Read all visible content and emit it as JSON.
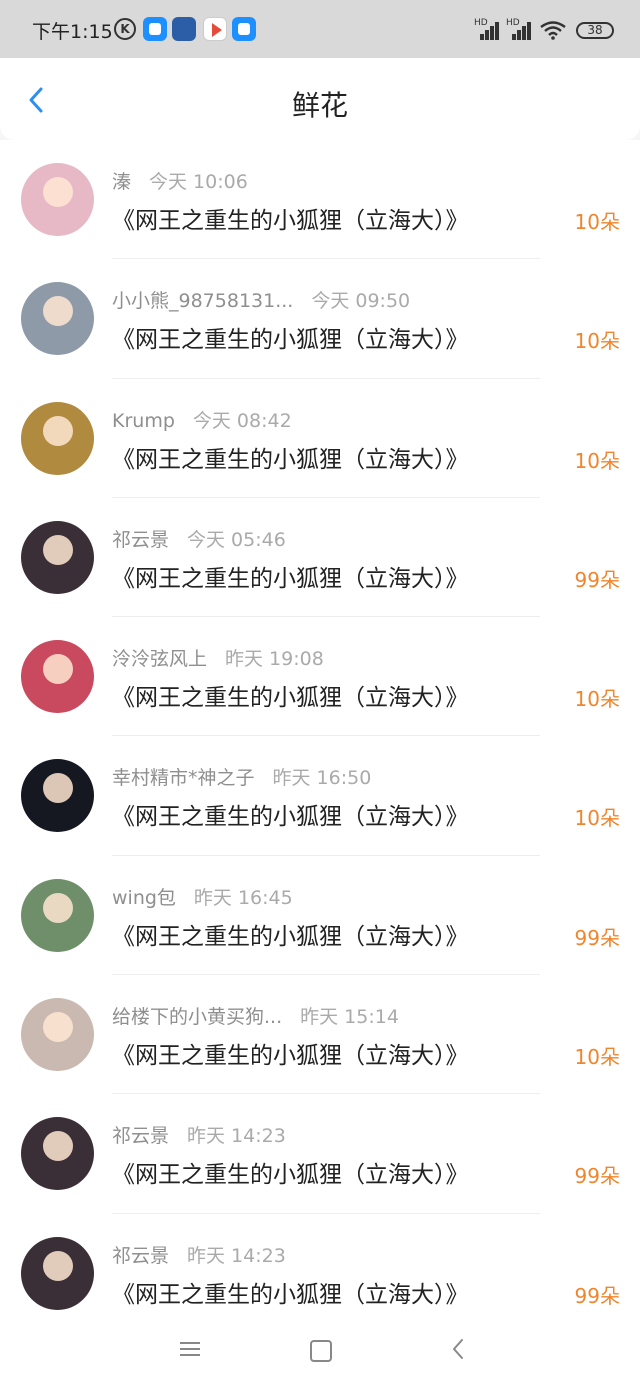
{
  "status_bar": {
    "time": "下午1:15",
    "k_icon": "K",
    "battery": "38",
    "icons": [
      "k-circle-icon",
      "blue-app-icon",
      "news-app-icon",
      "play-store-icon",
      "blue-app-icon",
      "hd-signal-icon",
      "hd-signal-icon",
      "wifi-icon",
      "battery-icon"
    ]
  },
  "header": {
    "title": "鲜花",
    "back_icon": "chevron-left-icon"
  },
  "colors": {
    "accent": "#2f8ff0",
    "amount": "#f0852d",
    "status_bar_bg": "#d9d9d9"
  },
  "items": [
    {
      "name": "溱",
      "time": "今天 10:06",
      "book": "《网王之重生的小狐狸（立海大）》",
      "amount": "10朵",
      "avatar_color": "#e7b9c6"
    },
    {
      "name": "小小熊_98758131...",
      "time": "今天 09:50",
      "book": "《网王之重生的小狐狸（立海大）》",
      "amount": "10朵",
      "avatar_color": "#8e9aa8"
    },
    {
      "name": "Krump",
      "time": "今天 08:42",
      "book": "《网王之重生的小狐狸（立海大）》",
      "amount": "10朵",
      "avatar_color": "#b08a3e"
    },
    {
      "name": "祁云景",
      "time": "今天 05:46",
      "book": "《网王之重生的小狐狸（立海大）》",
      "amount": "99朵",
      "avatar_color": "#3a2f36"
    },
    {
      "name": "泠泠弦风上",
      "time": "昨天 19:08",
      "book": "《网王之重生的小狐狸（立海大）》",
      "amount": "10朵",
      "avatar_color": "#c94a5e"
    },
    {
      "name": "幸村精市*神之子",
      "time": "昨天 16:50",
      "book": "《网王之重生的小狐狸（立海大）》",
      "amount": "10朵",
      "avatar_color": "#151820"
    },
    {
      "name": "wing包",
      "time": "昨天 16:45",
      "book": "《网王之重生的小狐狸（立海大）》",
      "amount": "99朵",
      "avatar_color": "#6f8f6a"
    },
    {
      "name": "给楼下的小黄买狗...",
      "time": "昨天 15:14",
      "book": "《网王之重生的小狐狸（立海大）》",
      "amount": "10朵",
      "avatar_color": "#c9b9b0"
    },
    {
      "name": "祁云景",
      "time": "昨天 14:23",
      "book": "《网王之重生的小狐狸（立海大）》",
      "amount": "99朵",
      "avatar_color": "#3a2f36"
    },
    {
      "name": "祁云景",
      "time": "昨天 14:23",
      "book": "《网王之重生的小狐狸（立海大）》",
      "amount": "99朵",
      "avatar_color": "#3a2f36"
    }
  ],
  "nav_bar": {
    "icons": [
      "menu-icon",
      "home-square-icon",
      "back-triangle-icon"
    ]
  }
}
